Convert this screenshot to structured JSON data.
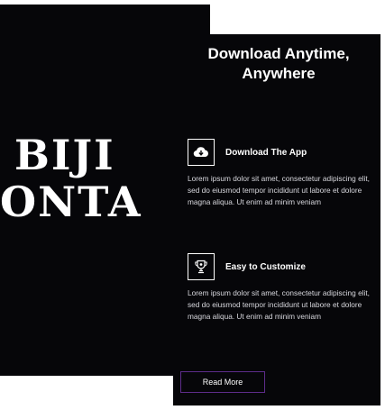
{
  "brand": {
    "line1": "BIJI",
    "line2": "ONTA"
  },
  "section": {
    "title": "Download Anytime, Anywhere"
  },
  "features": [
    {
      "icon": "cloud-download-icon",
      "title": "Download The App",
      "text": "Lorem ipsum dolor sit amet, consectetur adipiscing elit, sed do eiusmod tempor incididunt ut labore et dolore magna aliqua. Ut enim ad minim veniam"
    },
    {
      "icon": "trophy-icon",
      "title": "Easy to Customize",
      "text": "Lorem ipsum dolor sit amet, consectetur adipiscing elit, sed do eiusmod tempor incididunt ut labore et dolore magna aliqua. Ut enim ad minim veniam"
    }
  ],
  "cta": {
    "label": "Read More",
    "border_color": "#5d2c8a"
  },
  "colors": {
    "panel_bg": "#060609",
    "text": "#ffffff"
  }
}
